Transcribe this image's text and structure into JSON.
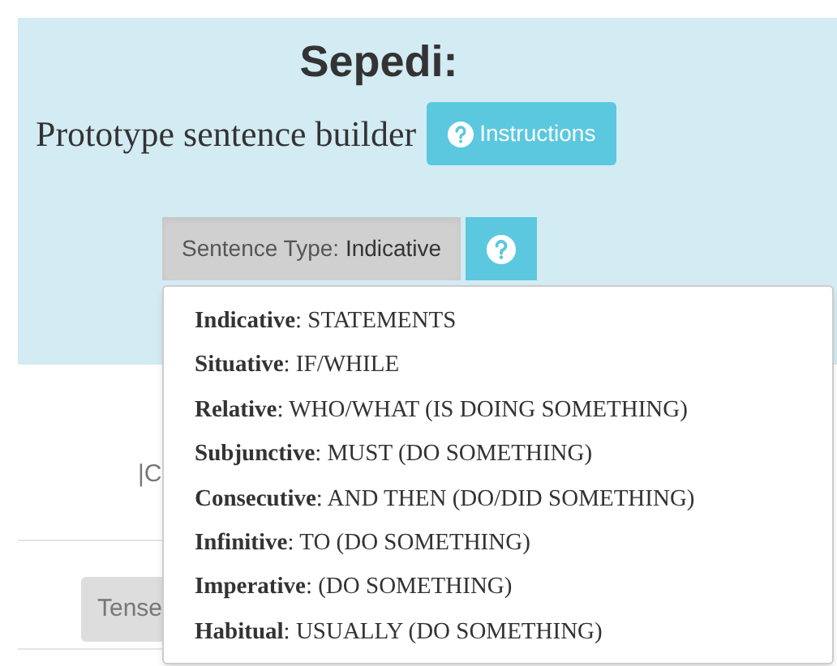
{
  "header": {
    "title": "Sepedi:",
    "subtitle": "Prototype sentence builder",
    "instructions_button": "Instructions"
  },
  "sentence_type": {
    "label": "Sentence Type:",
    "value": "Indicative",
    "expanded": true
  },
  "background": {
    "fragment": "|C",
    "tense_button": "Tense"
  },
  "dropdown": [
    {
      "text": "**Indicative**: STATEMENTS"
    },
    {
      "text": "**Situative**: IF/WHILE"
    },
    {
      "text": "**Relative**: WHO/WHAT (IS DOING SOMETHING)"
    },
    {
      "text": "**Subjunctive**: MUST (DO SOMETHING)"
    },
    {
      "text": "**Consecutive**: AND THEN (DO/DID SOMETHING)"
    },
    {
      "text": "**Infinitive**: TO (DO SOMETHING)"
    },
    {
      "text": "**Imperative**: (DO SOMETHING)"
    },
    {
      "text": "**Habitual**: USUALLY (DO SOMETHING)"
    }
  ]
}
